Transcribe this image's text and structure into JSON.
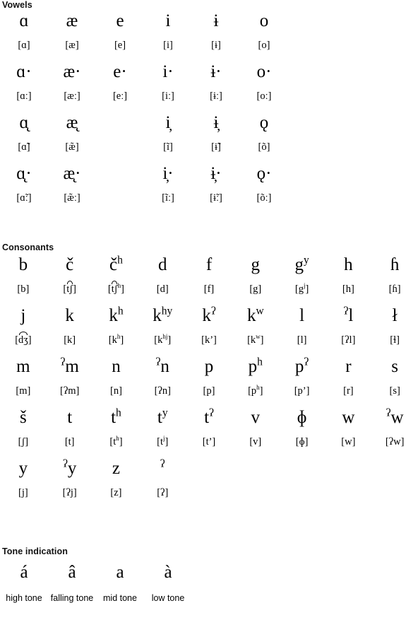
{
  "page": {
    "background": "#ffffff",
    "text_color": "#000000"
  },
  "sections": {
    "vowels": {
      "heading": "Vowels",
      "columns": 6,
      "rows": [
        {
          "type": "letters",
          "cells": [
            "ɑ",
            "æ",
            "e",
            "i",
            "ɨ",
            "o"
          ]
        },
        {
          "type": "ipa",
          "cells": [
            "[ɑ]",
            "[æ]",
            "[e]",
            "[i]",
            "[ɨ]",
            "[o]"
          ]
        },
        {
          "type": "letters",
          "cells": [
            "ɑ·",
            "æ·",
            "e·",
            "i·",
            "ɨ·",
            "o·"
          ]
        },
        {
          "type": "ipa",
          "cells": [
            "[ɑː]",
            "[æː]",
            "[eː]",
            "[iː]",
            "[ɨː]",
            "[oː]"
          ]
        },
        {
          "type": "letters",
          "cells": [
            "ɑ̨",
            "æ̨",
            "",
            "i̦",
            "ɨ̦",
            "ǫ"
          ]
        },
        {
          "type": "ipa",
          "cells": [
            "[ɑ̃]",
            "[æ̃]",
            "",
            "[ĩ]",
            "[ɨ̃]",
            "[õ]"
          ]
        },
        {
          "type": "letters",
          "cells": [
            "ɑ̨·",
            "æ̨·",
            "",
            "i̦·",
            "ɨ̦·",
            "ǫ·"
          ]
        },
        {
          "type": "ipa",
          "cells": [
            "[ɑ̃ː]",
            "[æ̃ː]",
            "",
            "[ĩː]",
            "[ɨ̃ː]",
            "[õː]"
          ]
        }
      ]
    },
    "consonants": {
      "heading": "Consonants",
      "columns": 9,
      "rows": [
        {
          "type": "letters",
          "cells": [
            {
              "base": "b"
            },
            {
              "base": "č"
            },
            {
              "base": "č",
              "sup": "h"
            },
            {
              "base": "d"
            },
            {
              "base": "f"
            },
            {
              "base": "g"
            },
            {
              "base": "g",
              "sup": "y"
            },
            {
              "base": "h"
            },
            {
              "base": "ɦ"
            }
          ]
        },
        {
          "type": "ipa",
          "cells": [
            {
              "text": "[b]"
            },
            {
              "open": "[",
              "tie": "t͡ʃ",
              "close": "]"
            },
            {
              "open": "[",
              "tie": "t͡ʃ",
              "sup": "h",
              "close": "]"
            },
            {
              "text": "[d]"
            },
            {
              "text": "[f]"
            },
            {
              "text": "[g]"
            },
            {
              "open": "[",
              "base": "g",
              "sup": "j",
              "close": "]"
            },
            {
              "text": "[h]"
            },
            {
              "text": "[ɦ]"
            }
          ]
        },
        {
          "type": "letters",
          "cells": [
            {
              "base": "j"
            },
            {
              "base": "k"
            },
            {
              "base": "k",
              "sup": "h"
            },
            {
              "base": "k",
              "sup": "hy"
            },
            {
              "base": "k",
              "sup": "ʔ"
            },
            {
              "base": "k",
              "sup": "w"
            },
            {
              "base": "l"
            },
            {
              "presup": "ʔ",
              "base": "l"
            },
            {
              "base": "ł"
            }
          ]
        },
        {
          "type": "ipa",
          "cells": [
            {
              "open": "[",
              "tie": "d͡ʒ",
              "close": "]"
            },
            {
              "text": "[k]"
            },
            {
              "open": "[",
              "base": "k",
              "sup": "h",
              "close": "]"
            },
            {
              "open": "[",
              "base": "k",
              "sup": "hj",
              "close": "]"
            },
            {
              "text": "[k’]"
            },
            {
              "open": "[",
              "base": "k",
              "sup": "w",
              "close": "]"
            },
            {
              "text": "[l]"
            },
            {
              "text": "[ʔl]"
            },
            {
              "text": "[ɬ]"
            }
          ]
        },
        {
          "type": "letters",
          "cells": [
            {
              "base": "m"
            },
            {
              "presup": "ʔ",
              "base": "m"
            },
            {
              "base": "n"
            },
            {
              "presup": "ʔ",
              "base": "n"
            },
            {
              "base": "p"
            },
            {
              "base": "p",
              "sup": "h"
            },
            {
              "base": "p",
              "sup": "ʔ"
            },
            {
              "base": "r"
            },
            {
              "base": "s"
            }
          ]
        },
        {
          "type": "ipa",
          "cells": [
            {
              "text": "[m]"
            },
            {
              "text": "[ʔm]"
            },
            {
              "text": "[n]"
            },
            {
              "text": "[ʔn]"
            },
            {
              "text": "[p]"
            },
            {
              "open": "[",
              "base": "p",
              "sup": "h",
              "close": "]"
            },
            {
              "text": "[p’]"
            },
            {
              "text": "[r]"
            },
            {
              "text": "[s]"
            }
          ]
        },
        {
          "type": "letters",
          "cells": [
            {
              "base": "š"
            },
            {
              "base": "t"
            },
            {
              "base": "t",
              "sup": "h"
            },
            {
              "base": "t",
              "sup": "y"
            },
            {
              "base": "t",
              "sup": "ʔ"
            },
            {
              "base": "v"
            },
            {
              "base": "ɸ"
            },
            {
              "base": "w"
            },
            {
              "presup": "ʔ",
              "base": "w"
            }
          ]
        },
        {
          "type": "ipa",
          "cells": [
            {
              "text": "[ʃ]"
            },
            {
              "text": "[t]"
            },
            {
              "open": "[",
              "base": "t",
              "sup": "h",
              "close": "]"
            },
            {
              "open": "[",
              "base": "t",
              "sup": "j",
              "close": "]"
            },
            {
              "text": "[t’]"
            },
            {
              "text": "[v]"
            },
            {
              "text": "[ɸ]"
            },
            {
              "text": "[w]"
            },
            {
              "text": "[ʔw]"
            }
          ]
        },
        {
          "type": "letters",
          "cells": [
            {
              "base": "y"
            },
            {
              "presup": "ʔ",
              "base": "y"
            },
            {
              "base": "z"
            },
            {
              "presup": "ʔ",
              "base": ""
            },
            {
              "base": ""
            },
            {
              "base": ""
            },
            {
              "base": ""
            },
            {
              "base": ""
            },
            {
              "base": ""
            }
          ]
        },
        {
          "type": "ipa",
          "cells": [
            {
              "text": "[j]"
            },
            {
              "text": "[ʔj]"
            },
            {
              "text": "[z]"
            },
            {
              "text": "[ʔ]"
            },
            {
              "text": ""
            },
            {
              "text": ""
            },
            {
              "text": ""
            },
            {
              "text": ""
            },
            {
              "text": ""
            }
          ]
        }
      ]
    },
    "tone": {
      "heading": "Tone indication",
      "columns": 4,
      "marks": [
        "á",
        "â",
        "a",
        "à"
      ],
      "labels": [
        "high tone",
        "falling tone",
        "mid tone",
        "low tone"
      ]
    }
  }
}
